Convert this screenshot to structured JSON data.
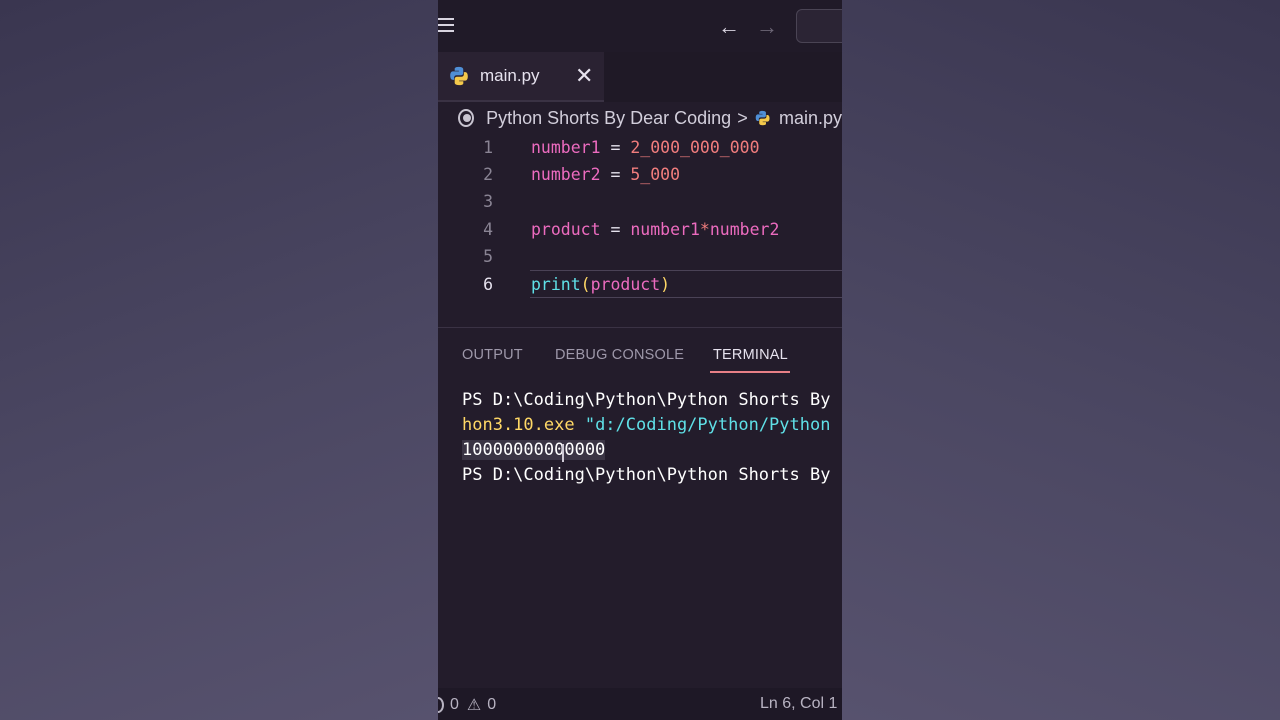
{
  "titlebar": {
    "back_icon": "arrow-left-icon",
    "forward_icon": "arrow-right-icon"
  },
  "tab": {
    "label": "main.py",
    "close": "✕"
  },
  "breadcrumb": {
    "folder": "Python Shorts By Dear Coding",
    "separator": ">",
    "file": "main.py"
  },
  "code": {
    "lines": [
      {
        "n": "1",
        "tokens": [
          [
            "var",
            "number1"
          ],
          [
            "op",
            " = "
          ],
          [
            "num",
            "2_000_000_000"
          ]
        ]
      },
      {
        "n": "2",
        "tokens": [
          [
            "var",
            "number2"
          ],
          [
            "op",
            " = "
          ],
          [
            "num",
            "5_000"
          ]
        ]
      },
      {
        "n": "3",
        "tokens": []
      },
      {
        "n": "4",
        "tokens": [
          [
            "var",
            "product"
          ],
          [
            "op",
            " = "
          ],
          [
            "var",
            "number1"
          ],
          [
            "num",
            "*"
          ],
          [
            "var",
            "number2"
          ]
        ]
      },
      {
        "n": "5",
        "tokens": []
      },
      {
        "n": "6",
        "tokens": [
          [
            "fn",
            "print"
          ],
          [
            "paren",
            "("
          ],
          [
            "var",
            "product"
          ],
          [
            "paren",
            ")"
          ]
        ]
      }
    ]
  },
  "panel": {
    "tabs": [
      "OUTPUT",
      "DEBUG CONSOLE",
      "TERMINAL"
    ],
    "active": "TERMINAL"
  },
  "terminal": {
    "line1": "PS D:\\Coding\\Python\\Python Shorts By",
    "line2_exe": "hon3.10.exe ",
    "line2_path": "\"d:/Coding/Python/Python",
    "line3": "10000000000000",
    "line4": "PS D:\\Coding\\Python\\Python Shorts By"
  },
  "status": {
    "errors": "0",
    "warnings": "0",
    "warn_icon": "⚠",
    "position": "Ln 6, Col 1"
  }
}
